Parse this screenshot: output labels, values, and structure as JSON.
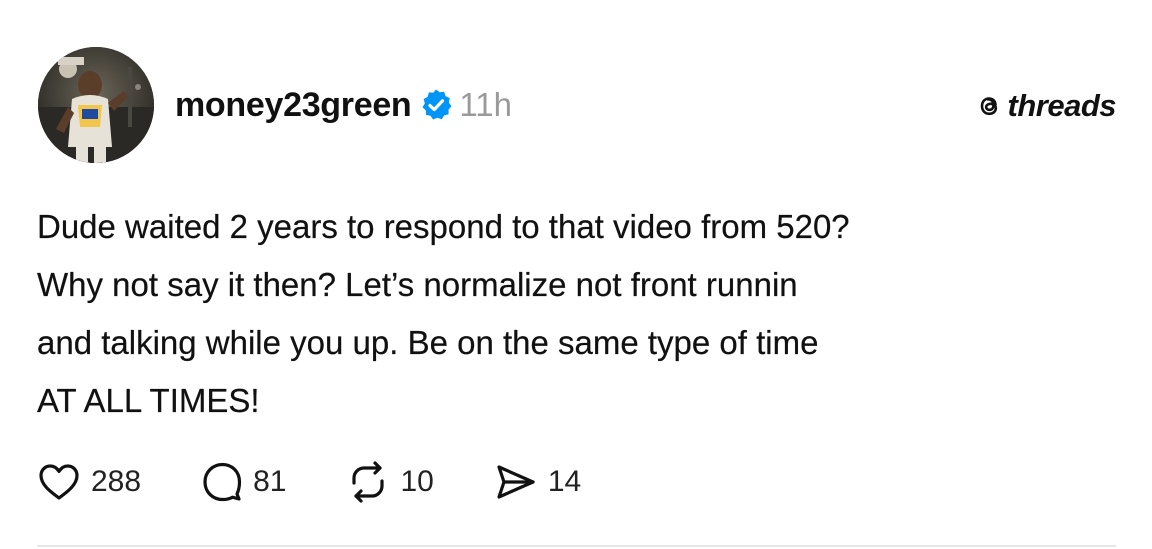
{
  "post": {
    "username": "money23green",
    "time": "11h",
    "brand": "threads",
    "text_lines": [
      "Dude waited 2 years to respond to that video from 520?",
      "Why not say it then? Let’s normalize not front runnin",
      "and talking while you up. Be on the same type of time",
      "AT ALL TIMES!"
    ],
    "actions": {
      "likes": "288",
      "replies": "81",
      "reposts": "10",
      "shares": "14"
    },
    "icons": {
      "verified": "verified-badge-icon",
      "brand": "threads-logo-icon",
      "like": "heart-icon",
      "reply": "comment-bubble-icon",
      "repost": "repost-icon",
      "share": "send-icon"
    },
    "colors": {
      "verified": "#0095f6",
      "text": "#111111",
      "muted": "#9a9a9a"
    }
  }
}
